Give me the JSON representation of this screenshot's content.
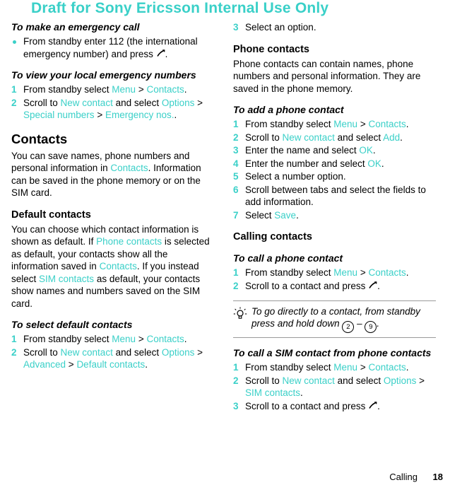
{
  "watermark": "Draft for Sony Ericsson Internal Use Only",
  "footer": {
    "chapter": "Calling",
    "page": "18"
  },
  "left_column": {
    "heading_emergency": "To make an emergency call",
    "bullet_emergency": "From standby enter 112 (the international emergency number) and press ",
    "heading_view_local": "To view your local emergency numbers",
    "steps_view_local": [
      {
        "num": "1",
        "text": "From standby select ",
        "link1": "Menu",
        "sep1": " > ",
        "link2": "Contacts",
        "tail": "."
      },
      {
        "num": "2",
        "text": "Scroll to ",
        "link1": "New contact",
        "sep1": " and select ",
        "link2": "Options",
        "sep2": " > ",
        "link3": "Special numbers",
        "sep3": " > ",
        "link4": "Emergency nos.",
        "tail": "."
      }
    ],
    "heading_contacts": "Contacts",
    "para_contacts_1": "You can save names, phone numbers and personal information in ",
    "para_contacts_link": "Contacts",
    "para_contacts_2": ". Information can be saved in the phone memory or on the SIM card.",
    "heading_default_contacts": "Default contacts",
    "para_default_1": "You can choose which contact information is shown as default. If ",
    "para_default_link1": "Phone contacts",
    "para_default_2": " is selected as default, your contacts show all the information saved in ",
    "para_default_link2": "Contacts",
    "para_default_3": ". If you instead select ",
    "para_default_link3": "SIM contacts",
    "para_default_4": " as default, your contacts show names and numbers saved on the SIM card.",
    "heading_select_default": "To select default contacts",
    "steps_select_default": [
      {
        "num": "1",
        "text": "From standby select ",
        "link1": "Menu",
        "sep1": " > ",
        "link2": "Contacts",
        "tail": "."
      },
      {
        "num": "2",
        "text": "Scroll to ",
        "link1": "New contact",
        "sep1": " and select ",
        "link2": "Options",
        "sep2": " > ",
        "link3": "Advanced",
        "sep3": " > ",
        "link4": "Default contacts",
        "tail": "."
      }
    ]
  },
  "right_column": {
    "step_select_option": {
      "num": "3",
      "text": "Select an option."
    },
    "heading_phone_contacts": "Phone contacts",
    "para_phone_contacts": "Phone contacts can contain names, phone numbers and personal information. They are saved in the phone memory.",
    "heading_add_contact": "To add a phone contact",
    "steps_add_contact": [
      {
        "num": "1",
        "text": "From standby select ",
        "link1": "Menu",
        "sep1": " > ",
        "link2": "Contacts",
        "tail": "."
      },
      {
        "num": "2",
        "text": "Scroll to ",
        "link1": "New contact",
        "sep1": " and select ",
        "link2": "Add",
        "tail": "."
      },
      {
        "num": "3",
        "text": "Enter the name and select ",
        "link1": "OK",
        "tail": "."
      },
      {
        "num": "4",
        "text": "Enter the number and select ",
        "link1": "OK",
        "tail": "."
      },
      {
        "num": "5",
        "text": "Select a number option."
      },
      {
        "num": "6",
        "text": "Scroll between tabs and select the fields to add information."
      },
      {
        "num": "7",
        "text": "Select ",
        "link1": "Save",
        "tail": "."
      }
    ],
    "heading_calling_contacts": "Calling contacts",
    "heading_call_phone_contact": "To call a phone contact",
    "steps_call_phone_contact": [
      {
        "num": "1",
        "text": "From standby select ",
        "link1": "Menu",
        "sep1": " > ",
        "link2": "Contacts",
        "tail": "."
      },
      {
        "num": "2",
        "text": "Scroll to a contact and press ",
        "tail": "."
      }
    ],
    "tip": {
      "text_1": "To go directly to a contact, from standby press and hold down ",
      "key_from": "2",
      "dash": " – ",
      "key_to": "9",
      "text_2": "."
    },
    "heading_call_sim_contact": "To call a SIM contact from phone contacts",
    "steps_call_sim_contact": [
      {
        "num": "1",
        "text": "From standby select ",
        "link1": "Menu",
        "sep1": " > ",
        "link2": "Contacts",
        "tail": "."
      },
      {
        "num": "2",
        "text": "Scroll to ",
        "link1": "New contact",
        "sep1": " and select ",
        "link2": "Options",
        "sep2": " > ",
        "link3": "SIM contacts",
        "tail": "."
      },
      {
        "num": "3",
        "text": "Scroll to a contact and press ",
        "tail": "."
      }
    ]
  },
  "colors": {
    "accent": "#3ad0c8",
    "text": "#000000"
  }
}
